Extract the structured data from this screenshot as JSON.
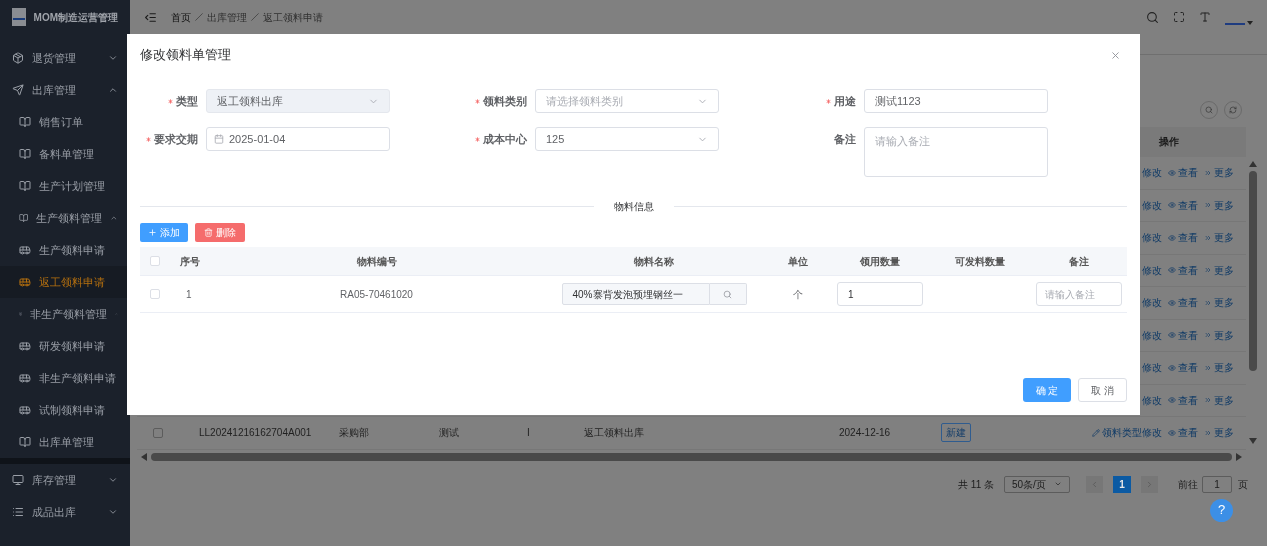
{
  "app": {
    "title": "MOM制造运营管理"
  },
  "breadcrumb": [
    "首页",
    "出库管理",
    "返工领料申请"
  ],
  "sidebar": {
    "items": [
      {
        "label": "退货管理",
        "expanded": false,
        "selected": false
      },
      {
        "label": "出库管理",
        "expanded": true,
        "selected": false,
        "children": [
          {
            "label": "销售订单",
            "selected": false
          },
          {
            "label": "备料单管理",
            "selected": false
          },
          {
            "label": "生产计划管理",
            "selected": false
          },
          {
            "label": "生产领料管理",
            "expanded": true,
            "selected": false,
            "children": [
              {
                "label": "生产领料申请",
                "selected": false
              },
              {
                "label": "返工领料申请",
                "selected": true
              }
            ]
          },
          {
            "label": "非生产领料管理",
            "expanded": true,
            "selected": false,
            "children": [
              {
                "label": "研发领料申请",
                "selected": false
              },
              {
                "label": "非生产领料申请",
                "selected": false
              },
              {
                "label": "试制领料申请",
                "selected": false
              }
            ]
          },
          {
            "label": "出库单管理",
            "selected": false
          }
        ]
      },
      {
        "label": "库存管理",
        "expanded": false,
        "selected": false
      },
      {
        "label": "成品出库",
        "expanded": false,
        "selected": false
      }
    ]
  },
  "background_table": {
    "action_header": "操作",
    "rows": [
      {
        "actions": [
          "修改",
          "查看",
          "更多"
        ]
      },
      {
        "actions": [
          "修改",
          "查看",
          "更多"
        ]
      },
      {
        "actions": [
          "修改",
          "查看",
          "更多"
        ]
      },
      {
        "actions": [
          "修改",
          "查看",
          "更多"
        ]
      },
      {
        "actions": [
          "修改",
          "查看",
          "更多"
        ]
      },
      {
        "actions": [
          "修改",
          "查看",
          "更多"
        ]
      },
      {
        "actions": [
          "修改",
          "查看",
          "更多"
        ]
      },
      {
        "actions": [
          "修改",
          "查看",
          "更多"
        ]
      },
      {
        "checked": false,
        "code": "LL20241216162704A001",
        "dept": "采购部",
        "purpose": "测试",
        "column_4": "I",
        "type": "返工领料出库",
        "date": "2024-12-16",
        "status": "新建",
        "actions": [
          "领料类型修改",
          "查看",
          "更多"
        ]
      }
    ]
  },
  "pagination": {
    "total": "共 11 条",
    "page_size": "50条/页",
    "pages": [
      {
        "label": "1",
        "selected": true
      }
    ],
    "goto_label": "前往",
    "goto_value": "1",
    "goto_suffix": "页"
  },
  "help": "?",
  "dialog": {
    "title": "修改领料单管理",
    "fields": [
      {
        "label": "类型",
        "kind": "select",
        "required": true,
        "disabled": true,
        "value": "返工领料出库"
      },
      {
        "label": "领料类别",
        "kind": "select",
        "required": true,
        "disabled": false,
        "placeholder": "请选择领料类别"
      },
      {
        "label": "用途",
        "kind": "input",
        "required": true,
        "disabled": false,
        "value": "测试1123"
      },
      {
        "label": "要求交期",
        "kind": "date",
        "required": true,
        "disabled": false,
        "value": "2025-01-04"
      },
      {
        "label": "成本中心",
        "kind": "select",
        "required": true,
        "disabled": false,
        "value": "125"
      },
      {
        "label": "备注",
        "kind": "textarea",
        "required": false,
        "disabled": false,
        "placeholder": "请输入备注"
      }
    ],
    "section_title": "物料信息",
    "add_button": "添加",
    "delete_button": "删除",
    "all_checked": false,
    "columns": [
      "序号",
      "物料编号",
      "物料名称",
      "单位",
      "领用数量",
      "可发料数量",
      "备注"
    ],
    "rows": [
      {
        "checked": false,
        "no": "1",
        "code": "RA05-70461020",
        "name": "40%寨背发泡预埋钢丝一",
        "unit": "个",
        "qty": "1",
        "remark_placeholder": "请输入备注"
      }
    ],
    "confirm": "确 定",
    "cancel": "取 消"
  }
}
